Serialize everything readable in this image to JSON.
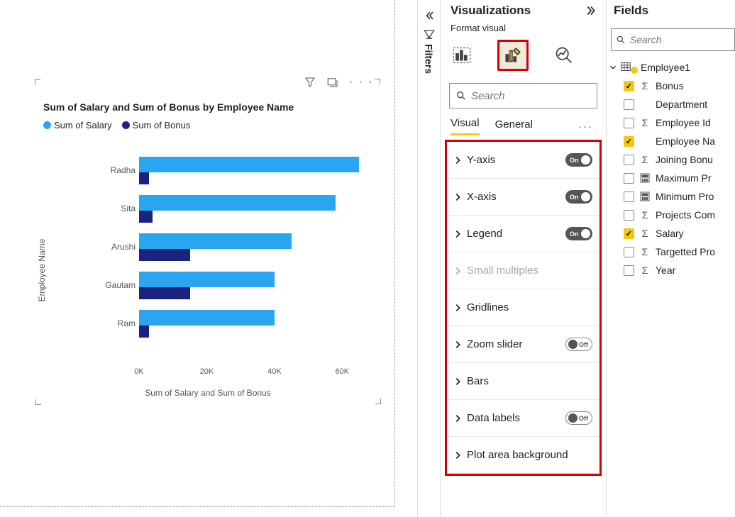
{
  "chart_data": {
    "type": "bar",
    "orientation": "horizontal",
    "title": "Sum of Salary and Sum of Bonus by Employee Name",
    "xlabel": "Sum of Salary and Sum of Bonus",
    "ylabel": "Employee Name",
    "xlim": [
      0,
      70000
    ],
    "x_ticks": [
      "0K",
      "20K",
      "40K",
      "60K"
    ],
    "categories": [
      "Radha",
      "Sita",
      "Arushi",
      "Gautam",
      "Ram"
    ],
    "series": [
      {
        "name": "Sum of Salary",
        "color": "#29a5f1",
        "values": [
          65000,
          58000,
          45000,
          40000,
          40000
        ]
      },
      {
        "name": "Sum of Bonus",
        "color": "#1a237e",
        "values": [
          3000,
          4000,
          15000,
          15000,
          3000
        ]
      }
    ],
    "legend": [
      "Sum of Salary",
      "Sum of Bonus"
    ]
  },
  "filters": {
    "label": "Filters"
  },
  "viz_pane": {
    "title": "Visualizations",
    "subtitle": "Format visual",
    "search_placeholder": "Search",
    "tabs": {
      "visual": "Visual",
      "general": "General"
    },
    "items": [
      {
        "label": "Y-axis",
        "toggle": "On",
        "state": "on"
      },
      {
        "label": "X-axis",
        "toggle": "On",
        "state": "on"
      },
      {
        "label": "Legend",
        "toggle": "On",
        "state": "on"
      },
      {
        "label": "Small multiples",
        "toggle": null,
        "state": "disabled"
      },
      {
        "label": "Gridlines",
        "toggle": null,
        "state": "normal"
      },
      {
        "label": "Zoom slider",
        "toggle": "Off",
        "state": "off"
      },
      {
        "label": "Bars",
        "toggle": null,
        "state": "normal"
      },
      {
        "label": "Data labels",
        "toggle": "Off",
        "state": "off"
      },
      {
        "label": "Plot area background",
        "toggle": null,
        "state": "normal"
      }
    ]
  },
  "fields_pane": {
    "title": "Fields",
    "search_placeholder": "Search",
    "table": "Employee1",
    "fields": [
      {
        "name": "Bonus",
        "checked": true,
        "type": "sigma"
      },
      {
        "name": "Department",
        "checked": false,
        "type": "blank"
      },
      {
        "name": "Employee Id",
        "checked": false,
        "type": "sigma"
      },
      {
        "name": "Employee Na",
        "checked": true,
        "type": "blank"
      },
      {
        "name": "Joining Bonu",
        "checked": false,
        "type": "sigma"
      },
      {
        "name": "Maximum Pr",
        "checked": false,
        "type": "calc"
      },
      {
        "name": "Minimum Pro",
        "checked": false,
        "type": "calc"
      },
      {
        "name": "Projects Com",
        "checked": false,
        "type": "sigma"
      },
      {
        "name": "Salary",
        "checked": true,
        "type": "sigma"
      },
      {
        "name": "Targetted Pro",
        "checked": false,
        "type": "sigma"
      },
      {
        "name": "Year",
        "checked": false,
        "type": "sigma"
      }
    ]
  }
}
